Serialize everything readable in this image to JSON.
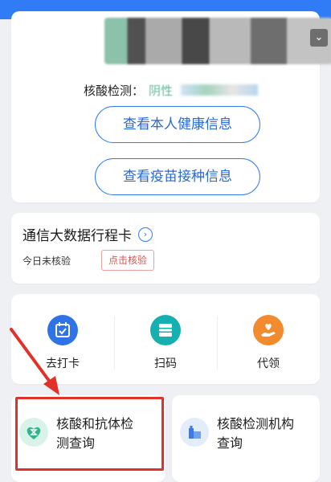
{
  "health": {
    "nucleic_label": "核酸检测：",
    "nucleic_result": "阴性",
    "view_health_button": "查看本人健康信息",
    "view_vaccine_button": "查看疫苗接种信息"
  },
  "trip_card": {
    "title": "通信大数据行程卡",
    "status": "今日未核验",
    "verify_button": "点击核验"
  },
  "actions": [
    {
      "label": "去打卡",
      "icon": "calendar-check-icon"
    },
    {
      "label": "扫码",
      "icon": "scan-icon"
    },
    {
      "label": "代领",
      "icon": "hand-heart-icon"
    }
  ],
  "queries": [
    {
      "line1": "核酸和抗体检",
      "line2": "测查询",
      "icon": "heart-hourglass-icon"
    },
    {
      "line1": "核酸检测机构",
      "line2": "查询",
      "icon": "hospital-building-icon"
    }
  ],
  "colors": {
    "top_bar": "#2f7cf6",
    "accent_blue": "#2f7cf6",
    "result_green": "#62b897",
    "annotation_red": "#e2302a"
  }
}
